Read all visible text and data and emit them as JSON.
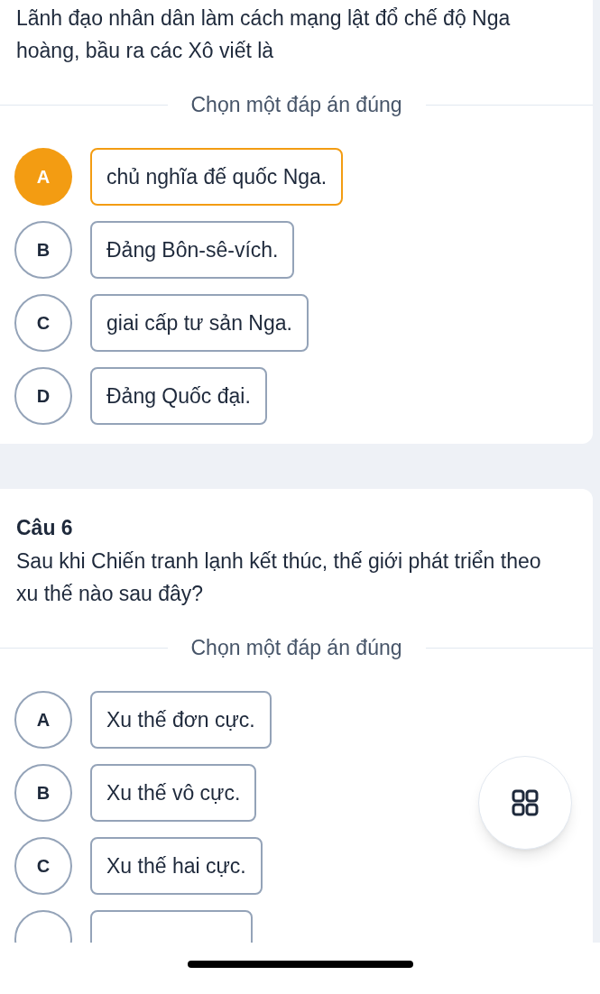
{
  "cards": [
    {
      "question": "Lãnh đạo nhân dân làm cách mạng lật đổ chế độ Nga hoàng, bầu ra các Xô viết là",
      "prompt": "Chọn một đáp án đúng",
      "options": [
        {
          "letter": "A",
          "text": "chủ nghĩa đế quốc Nga.",
          "selected": true
        },
        {
          "letter": "B",
          "text": "Đảng Bôn-sê-vích.",
          "selected": false
        },
        {
          "letter": "C",
          "text": "giai cấp tư sản Nga.",
          "selected": false
        },
        {
          "letter": "D",
          "text": "Đảng Quốc đại.",
          "selected": false
        }
      ],
      "more_options_below": false
    },
    {
      "title": "Câu 6",
      "question": "Sau khi Chiến tranh lạnh kết thúc, thế giới phát triển theo xu thế nào sau đây?",
      "prompt": "Chọn một đáp án đúng",
      "options": [
        {
          "letter": "A",
          "text": "Xu thế đơn cực.",
          "selected": false
        },
        {
          "letter": "B",
          "text": "Xu thế vô cực.",
          "selected": false
        },
        {
          "letter": "C",
          "text": "Xu thế hai cực.",
          "selected": false
        }
      ],
      "more_options_below": true
    }
  ]
}
